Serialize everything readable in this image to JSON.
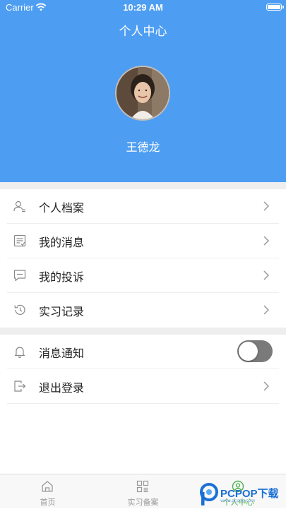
{
  "status_bar": {
    "carrier": "Carrier",
    "time": "10:29 AM"
  },
  "header": {
    "title": "个人中心",
    "username": "王德龙"
  },
  "menu_group_1": [
    {
      "label": "个人档案",
      "icon": "user-profile-icon"
    },
    {
      "label": "我的消息",
      "icon": "message-doc-icon"
    },
    {
      "label": "我的投诉",
      "icon": "comment-icon"
    },
    {
      "label": "实习记录",
      "icon": "history-icon"
    }
  ],
  "menu_group_2": [
    {
      "label": "消息通知",
      "icon": "bell-icon",
      "control": "toggle",
      "toggle_on": false
    },
    {
      "label": "退出登录",
      "icon": "logout-icon"
    }
  ],
  "tabbar": {
    "tabs": [
      {
        "label": "首页",
        "icon": "home-icon",
        "active": false
      },
      {
        "label": "实习备案",
        "icon": "grid-list-icon",
        "active": false
      },
      {
        "label": "个人中心",
        "icon": "person-circle-icon",
        "active": true
      }
    ]
  },
  "watermark": {
    "text": "PCPOP下载",
    "sub": "www.pcpop.com"
  },
  "colors": {
    "header_bg": "#4d9df2",
    "active_tab": "#4caf50",
    "toggle_off": "#7a7a7a"
  }
}
